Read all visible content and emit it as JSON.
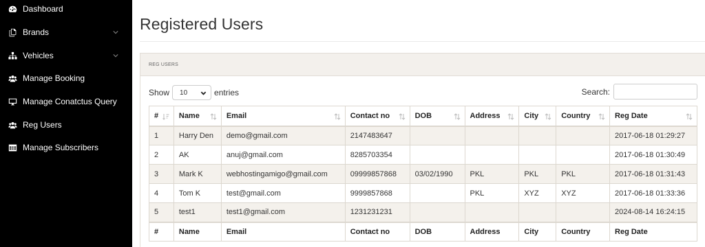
{
  "sidebar": {
    "items": [
      {
        "label": "Dashboard",
        "icon": "dashboard-icon",
        "has_submenu": false
      },
      {
        "label": "Brands",
        "icon": "files-icon",
        "has_submenu": true
      },
      {
        "label": "Vehicles",
        "icon": "sitemap-icon",
        "has_submenu": true
      },
      {
        "label": "Manage Booking",
        "icon": "users-icon",
        "has_submenu": false
      },
      {
        "label": "Manage Conatctus Query",
        "icon": "desktop-icon",
        "has_submenu": false
      },
      {
        "label": "Reg Users",
        "icon": "users-icon",
        "has_submenu": false
      },
      {
        "label": "Manage Subscribers",
        "icon": "table-icon",
        "has_submenu": false
      }
    ]
  },
  "page": {
    "title": "Registered Users",
    "panel_heading": "REG USERS"
  },
  "controls": {
    "show_label": "Show",
    "entries_value": "10",
    "entries_label": "entries",
    "search_label": "Search:",
    "search_value": ""
  },
  "table": {
    "headers": [
      "#",
      "Name",
      "Email",
      "Contact no",
      "DOB",
      "Address",
      "City",
      "Country",
      "Reg Date"
    ],
    "rows": [
      [
        "1",
        "Harry Den",
        "demo@gmail.com",
        "2147483647",
        "",
        "",
        "",
        "",
        "2017-06-18 01:29:27"
      ],
      [
        "2",
        "AK",
        "anuj@gmail.com",
        "8285703354",
        "",
        "",
        "",
        "",
        "2017-06-18 01:30:49"
      ],
      [
        "3",
        "Mark K",
        "webhostingamigo@gmail.com",
        "09999857868",
        "03/02/1990",
        "PKL",
        "PKL",
        "PKL",
        "2017-06-18 01:31:43"
      ],
      [
        "4",
        "Tom K",
        "test@gmail.com",
        "9999857868",
        "",
        "PKL",
        "XYZ",
        "XYZ",
        "2017-06-18 01:33:36"
      ],
      [
        "5",
        "test1",
        "test1@gmail.com",
        "1231231231",
        "",
        "",
        "",
        "",
        "2024-08-14 16:24:15"
      ]
    ]
  },
  "colors": {
    "sidebar_bg": "#000000",
    "panel_heading_bg": "#f3f0ec",
    "row_stripe": "#f4f1ec"
  }
}
